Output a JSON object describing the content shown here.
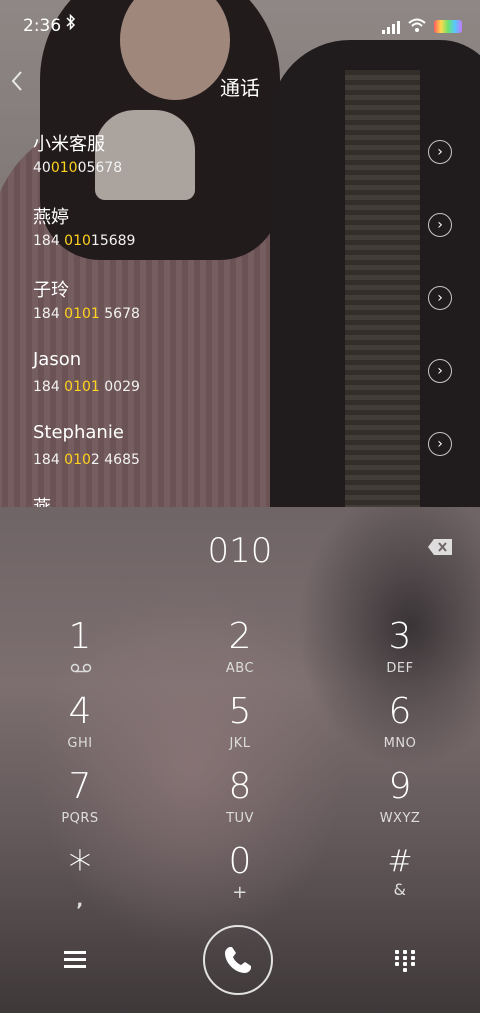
{
  "status_bar": {
    "time": "2:36",
    "bluetooth_icon": "bluetooth-icon",
    "signal_icon": "signal-icon",
    "wifi_icon": "wifi-icon",
    "battery_icon": "battery-icon"
  },
  "header": {
    "title": "通话",
    "back_icon": "chevron-left-icon"
  },
  "contacts": [
    {
      "name": "小米客服",
      "number_pre": "40",
      "number_hl": "010",
      "number_post": "05678"
    },
    {
      "name": "燕婷",
      "number_pre": "184 ",
      "number_hl": "010",
      "number_post": "15689"
    },
    {
      "name": "子玲",
      "number_pre": "184 ",
      "number_hl": "0101",
      "number_post": " 5678"
    },
    {
      "name": "Jason",
      "number_pre": "184 ",
      "number_hl": "0101",
      "number_post": " 0029"
    },
    {
      "name": "Stephanie",
      "number_pre": "184 ",
      "number_hl": "010",
      "number_post": "2 4685"
    },
    {
      "name": "燕...",
      "number_pre": "",
      "number_hl": "",
      "number_post": ""
    }
  ],
  "dialer": {
    "entered": "010",
    "keys": [
      [
        {
          "d": "1",
          "s": ""
        },
        {
          "d": "2",
          "s": "ABC"
        },
        {
          "d": "3",
          "s": "DEF"
        }
      ],
      [
        {
          "d": "4",
          "s": "GHI"
        },
        {
          "d": "5",
          "s": "JKL"
        },
        {
          "d": "6",
          "s": "MNO"
        }
      ],
      [
        {
          "d": "7",
          "s": "PQRS"
        },
        {
          "d": "8",
          "s": "TUV"
        },
        {
          "d": "9",
          "s": "WXYZ"
        }
      ],
      [
        {
          "d": "*",
          "s": ","
        },
        {
          "d": "0",
          "s": "+"
        },
        {
          "d": "#",
          "s": "&"
        }
      ]
    ],
    "accent_highlight": "#ffd21f"
  }
}
